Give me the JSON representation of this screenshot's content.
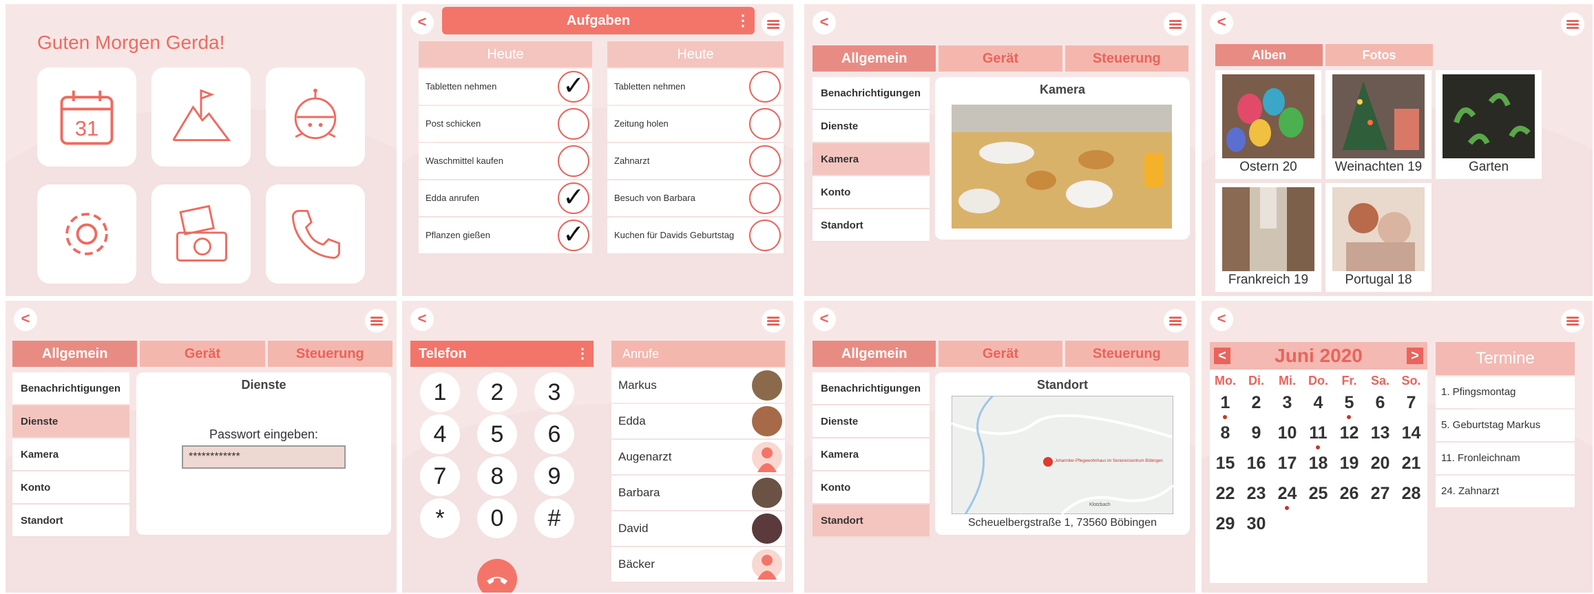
{
  "home": {
    "greeting": "Guten Morgen Gerda!",
    "calendar_day": "31"
  },
  "tasks": {
    "title": "Aufgaben",
    "left": {
      "header": "Heute",
      "items": [
        {
          "text": "Tabletten nehmen",
          "done": true
        },
        {
          "text": "Post schicken",
          "done": false
        },
        {
          "text": "Waschmittel kaufen",
          "done": false
        },
        {
          "text": "Edda anrufen",
          "done": true
        },
        {
          "text": "Pflanzen gießen",
          "done": true
        }
      ]
    },
    "right": {
      "header": "Heute",
      "items": [
        {
          "text": "Tabletten nehmen",
          "done": false
        },
        {
          "text": "Zeitung holen",
          "done": false
        },
        {
          "text": "Zahnarzt",
          "done": false
        },
        {
          "text": "Besuch von Barbara",
          "done": false
        },
        {
          "text": "Kuchen für Davids Geburtstag",
          "done": false
        }
      ]
    }
  },
  "settings": {
    "tabs": [
      "Allgemein",
      "Gerät",
      "Steuerung"
    ],
    "side": [
      "Benachrichtigungen",
      "Dienste",
      "Kamera",
      "Konto",
      "Standort"
    ],
    "camera_title": "Kamera",
    "services_title": "Dienste",
    "password_label": "Passwort eingeben:",
    "password_value": "************",
    "location_title": "Standort",
    "address": "Scheuelbergstraße 1, 73560 Böbingen",
    "map_labels": [
      "Johanniter-Pflegewohnhaus im Seniorenzentrum Böbingen",
      "Klotzbach"
    ]
  },
  "albums": {
    "tabs": [
      "Alben",
      "Fotos"
    ],
    "items": [
      "Ostern 20",
      "Weinachten 19",
      "Garten",
      "Frankreich 19",
      "Portugal 18"
    ]
  },
  "phone": {
    "title": "Telefon",
    "keys": [
      "1",
      "2",
      "3",
      "4",
      "5",
      "6",
      "7",
      "8",
      "9",
      "*",
      "0",
      "#"
    ],
    "calls_header": "Anrufe",
    "contacts": [
      "Markus",
      "Edda",
      "Augenarzt",
      "Barbara",
      "David",
      "Bäcker"
    ]
  },
  "calendar": {
    "month": "Juni 2020",
    "weekdays": [
      "Mo.",
      "Di.",
      "Mi.",
      "Do.",
      "Fr.",
      "Sa.",
      "So."
    ],
    "days": [
      "1",
      "2",
      "3",
      "4",
      "5",
      "6",
      "7",
      "8",
      "9",
      "10",
      "11",
      "12",
      "13",
      "14",
      "15",
      "16",
      "17",
      "18",
      "19",
      "20",
      "21",
      "22",
      "23",
      "24",
      "25",
      "26",
      "27",
      "28",
      "29",
      "30"
    ],
    "terms_header": "Termine",
    "terms": [
      "1. Pfingsmontag",
      "5. Geburtstag Markus",
      "11. Fronleichnam",
      "24. Zahnarzt"
    ]
  }
}
